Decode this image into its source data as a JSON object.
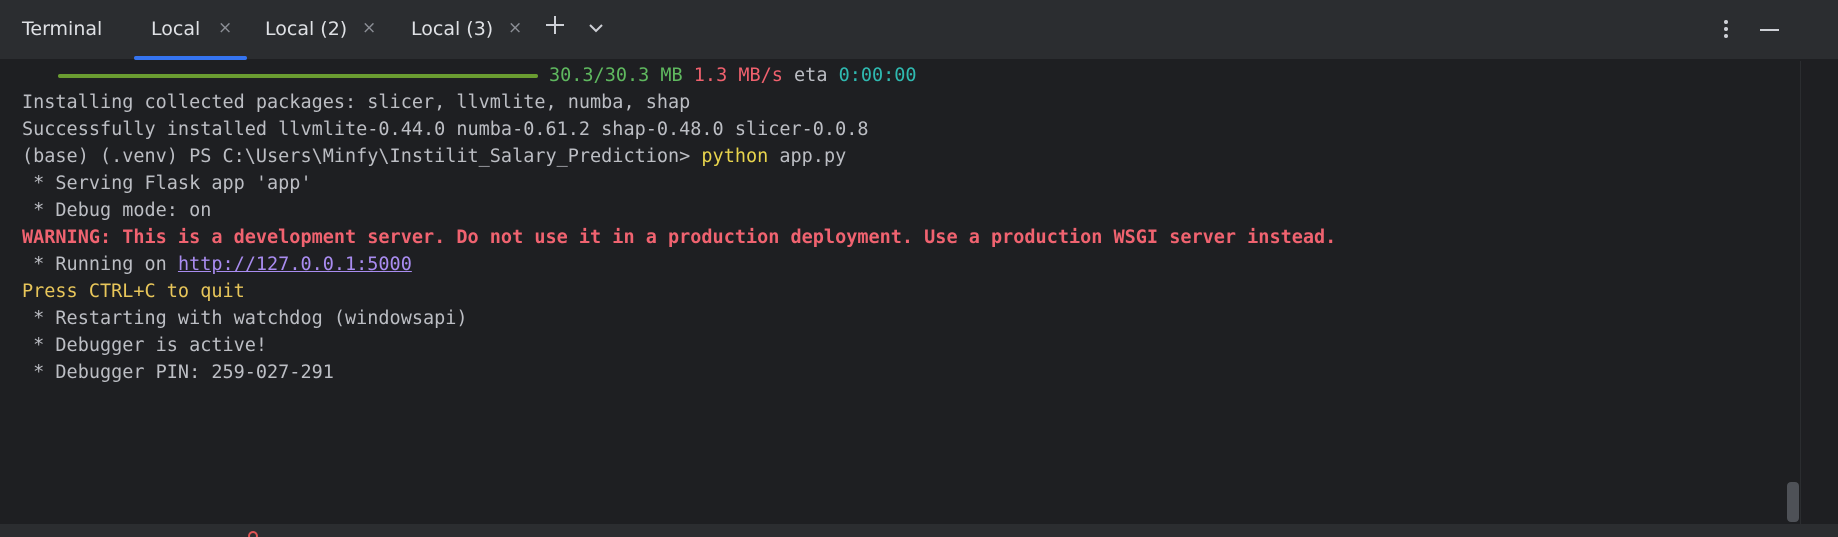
{
  "header": {
    "title": "Terminal",
    "tabs": [
      {
        "label": "Local",
        "close": "×"
      },
      {
        "label": "Local (2)",
        "close": "×"
      },
      {
        "label": "Local (3)",
        "close": "×"
      }
    ],
    "new_tab_icon": "plus-icon",
    "dropdown_icon": "chevron-down-icon",
    "options_icon": "kebab-menu-icon",
    "minimize_icon": "minimize-icon"
  },
  "terminal": {
    "progress": {
      "fraction": 1.0,
      "size": "30.3/30.3 MB",
      "speed": "1.3 MB/s",
      "eta_label": "eta",
      "eta_value": "0:00:00"
    },
    "lines": [
      "Installing collected packages: slicer, llvmlite, numba, shap",
      "Successfully installed llvmlite-0.44.0 numba-0.61.2 shap-0.48.0 slicer-0.0.8"
    ],
    "prompt": {
      "text": "(base) (.venv) PS C:\\Users\\Minfy\\Instilit_Salary_Prediction> ",
      "command": "python",
      "args": " app.py"
    },
    "flask_serving": " * Serving Flask app 'app'",
    "flask_debug": " * Debug mode: on",
    "warning": "WARNING: This is a development server. Do not use it in a production deployment. Use a production WSGI server instead.",
    "running_prefix": " * Running on ",
    "running_url": "http://127.0.0.1:5000",
    "press_quit": "Press CTRL+C to quit",
    "restarting": " * Restarting with watchdog (windowsapi)",
    "debugger_active": " * Debugger is active!",
    "debugger_pin": " * Debugger PIN: 259-027-291"
  },
  "colors": {
    "background": "#1e1f22",
    "header": "#2b2d30",
    "accent": "#3574f0",
    "progress": "#6a9c31",
    "warning": "#f06370",
    "link": "#a98cf0",
    "command": "#e8d44d"
  }
}
